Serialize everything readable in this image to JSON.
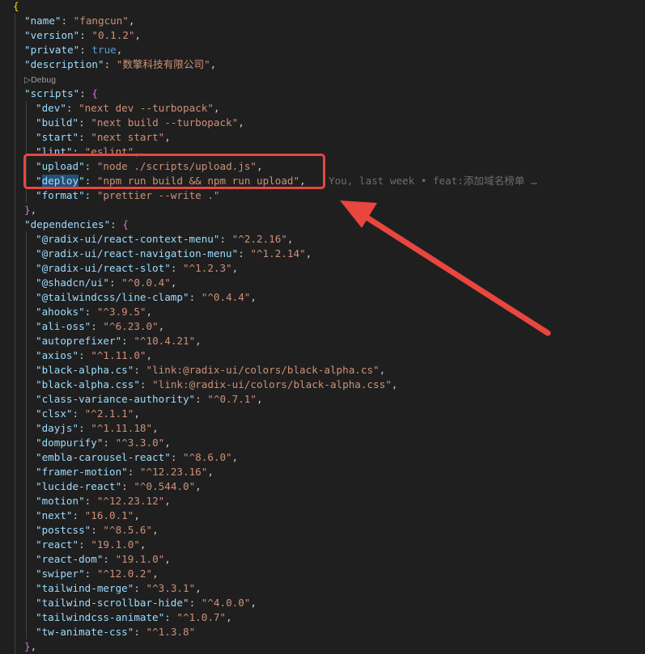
{
  "editor": {
    "lines": [
      {
        "segments": [
          {
            "t": "{",
            "c": "brace"
          }
        ]
      },
      {
        "indent": 1,
        "segments": [
          {
            "t": "\"name\"",
            "c": "key"
          },
          {
            "t": ": ",
            "c": "punct"
          },
          {
            "t": "\"fangcun\"",
            "c": "str"
          },
          {
            "t": ",",
            "c": "punct"
          }
        ]
      },
      {
        "indent": 1,
        "segments": [
          {
            "t": "\"version\"",
            "c": "key"
          },
          {
            "t": ": ",
            "c": "punct"
          },
          {
            "t": "\"0.1.2\"",
            "c": "str"
          },
          {
            "t": ",",
            "c": "punct"
          }
        ]
      },
      {
        "indent": 1,
        "segments": [
          {
            "t": "\"private\"",
            "c": "key"
          },
          {
            "t": ": ",
            "c": "punct"
          },
          {
            "t": "true",
            "c": "bool"
          },
          {
            "t": ",",
            "c": "punct"
          }
        ]
      },
      {
        "indent": 1,
        "segments": [
          {
            "t": "\"description\"",
            "c": "key"
          },
          {
            "t": ": ",
            "c": "punct"
          },
          {
            "t": "\"数擎科技有限公司\"",
            "c": "str"
          },
          {
            "t": ",",
            "c": "punct"
          }
        ]
      },
      {
        "indent": 1,
        "codelens": "▷Debug"
      },
      {
        "indent": 1,
        "segments": [
          {
            "t": "\"scripts\"",
            "c": "key"
          },
          {
            "t": ": ",
            "c": "punct"
          },
          {
            "t": "{",
            "c": "brace2"
          }
        ]
      },
      {
        "indent": 2,
        "segments": [
          {
            "t": "\"dev\"",
            "c": "key"
          },
          {
            "t": ": ",
            "c": "punct"
          },
          {
            "t": "\"next dev --turbopack\"",
            "c": "str"
          },
          {
            "t": ",",
            "c": "punct"
          }
        ]
      },
      {
        "indent": 2,
        "segments": [
          {
            "t": "\"build\"",
            "c": "key"
          },
          {
            "t": ": ",
            "c": "punct"
          },
          {
            "t": "\"next build --turbopack\"",
            "c": "str"
          },
          {
            "t": ",",
            "c": "punct"
          }
        ]
      },
      {
        "indent": 2,
        "segments": [
          {
            "t": "\"start\"",
            "c": "key"
          },
          {
            "t": ": ",
            "c": "punct"
          },
          {
            "t": "\"next start\"",
            "c": "str"
          },
          {
            "t": ",",
            "c": "punct"
          }
        ]
      },
      {
        "indent": 2,
        "segments": [
          {
            "t": "\"lint\"",
            "c": "key"
          },
          {
            "t": ": ",
            "c": "punct"
          },
          {
            "t": "\"eslint\"",
            "c": "str"
          },
          {
            "t": ",",
            "c": "punct"
          }
        ]
      },
      {
        "indent": 2,
        "segments": [
          {
            "t": "\"upload\"",
            "c": "key"
          },
          {
            "t": ": ",
            "c": "punct"
          },
          {
            "t": "\"node ./scripts/upload.js\"",
            "c": "str"
          },
          {
            "t": ",",
            "c": "punct"
          }
        ]
      },
      {
        "indent": 2,
        "segments": [
          {
            "t": "\"",
            "c": "key"
          },
          {
            "t": "deploy",
            "c": "key sel"
          },
          {
            "t": "\"",
            "c": "key"
          },
          {
            "t": ": ",
            "c": "punct"
          },
          {
            "t": "\"npm run build && npm run upload\"",
            "c": "str"
          },
          {
            "t": ",",
            "c": "punct"
          }
        ],
        "blame": "You, last week • feat:添加域名榜单 …"
      },
      {
        "indent": 2,
        "segments": [
          {
            "t": "\"format\"",
            "c": "key"
          },
          {
            "t": ": ",
            "c": "punct"
          },
          {
            "t": "\"prettier --write .\"",
            "c": "str"
          }
        ]
      },
      {
        "indent": 1,
        "segments": [
          {
            "t": "}",
            "c": "brace2"
          },
          {
            "t": ",",
            "c": "punct"
          }
        ]
      },
      {
        "indent": 1,
        "segments": [
          {
            "t": "\"dependencies\"",
            "c": "key"
          },
          {
            "t": ": ",
            "c": "punct"
          },
          {
            "t": "{",
            "c": "brace2"
          }
        ]
      },
      {
        "indent": 2,
        "segments": [
          {
            "t": "\"@radix-ui/react-context-menu\"",
            "c": "key"
          },
          {
            "t": ": ",
            "c": "punct"
          },
          {
            "t": "\"^2.2.16\"",
            "c": "str"
          },
          {
            "t": ",",
            "c": "punct"
          }
        ]
      },
      {
        "indent": 2,
        "segments": [
          {
            "t": "\"@radix-ui/react-navigation-menu\"",
            "c": "key"
          },
          {
            "t": ": ",
            "c": "punct"
          },
          {
            "t": "\"^1.2.14\"",
            "c": "str"
          },
          {
            "t": ",",
            "c": "punct"
          }
        ]
      },
      {
        "indent": 2,
        "segments": [
          {
            "t": "\"@radix-ui/react-slot\"",
            "c": "key"
          },
          {
            "t": ": ",
            "c": "punct"
          },
          {
            "t": "\"^1.2.3\"",
            "c": "str"
          },
          {
            "t": ",",
            "c": "punct"
          }
        ]
      },
      {
        "indent": 2,
        "segments": [
          {
            "t": "\"@shadcn/ui\"",
            "c": "key"
          },
          {
            "t": ": ",
            "c": "punct"
          },
          {
            "t": "\"^0.0.4\"",
            "c": "str"
          },
          {
            "t": ",",
            "c": "punct"
          }
        ]
      },
      {
        "indent": 2,
        "segments": [
          {
            "t": "\"@tailwindcss/line-clamp\"",
            "c": "key"
          },
          {
            "t": ": ",
            "c": "punct"
          },
          {
            "t": "\"^0.4.4\"",
            "c": "str"
          },
          {
            "t": ",",
            "c": "punct"
          }
        ]
      },
      {
        "indent": 2,
        "segments": [
          {
            "t": "\"ahooks\"",
            "c": "key"
          },
          {
            "t": ": ",
            "c": "punct"
          },
          {
            "t": "\"^3.9.5\"",
            "c": "str"
          },
          {
            "t": ",",
            "c": "punct"
          }
        ]
      },
      {
        "indent": 2,
        "segments": [
          {
            "t": "\"ali-oss\"",
            "c": "key"
          },
          {
            "t": ": ",
            "c": "punct"
          },
          {
            "t": "\"^6.23.0\"",
            "c": "str"
          },
          {
            "t": ",",
            "c": "punct"
          }
        ]
      },
      {
        "indent": 2,
        "segments": [
          {
            "t": "\"autoprefixer\"",
            "c": "key"
          },
          {
            "t": ": ",
            "c": "punct"
          },
          {
            "t": "\"^10.4.21\"",
            "c": "str"
          },
          {
            "t": ",",
            "c": "punct"
          }
        ]
      },
      {
        "indent": 2,
        "segments": [
          {
            "t": "\"axios\"",
            "c": "key"
          },
          {
            "t": ": ",
            "c": "punct"
          },
          {
            "t": "\"^1.11.0\"",
            "c": "str"
          },
          {
            "t": ",",
            "c": "punct"
          }
        ]
      },
      {
        "indent": 2,
        "segments": [
          {
            "t": "\"black-alpha.cs\"",
            "c": "key"
          },
          {
            "t": ": ",
            "c": "punct"
          },
          {
            "t": "\"link:@radix-ui/colors/black-alpha.cs\"",
            "c": "str"
          },
          {
            "t": ",",
            "c": "punct"
          }
        ]
      },
      {
        "indent": 2,
        "segments": [
          {
            "t": "\"black-alpha.css\"",
            "c": "key"
          },
          {
            "t": ": ",
            "c": "punct"
          },
          {
            "t": "\"link:@radix-ui/colors/black-alpha.css\"",
            "c": "str"
          },
          {
            "t": ",",
            "c": "punct"
          }
        ]
      },
      {
        "indent": 2,
        "segments": [
          {
            "t": "\"class-variance-authority\"",
            "c": "key"
          },
          {
            "t": ": ",
            "c": "punct"
          },
          {
            "t": "\"^0.7.1\"",
            "c": "str"
          },
          {
            "t": ",",
            "c": "punct"
          }
        ]
      },
      {
        "indent": 2,
        "segments": [
          {
            "t": "\"clsx\"",
            "c": "key"
          },
          {
            "t": ": ",
            "c": "punct"
          },
          {
            "t": "\"^2.1.1\"",
            "c": "str"
          },
          {
            "t": ",",
            "c": "punct"
          }
        ]
      },
      {
        "indent": 2,
        "segments": [
          {
            "t": "\"dayjs\"",
            "c": "key"
          },
          {
            "t": ": ",
            "c": "punct"
          },
          {
            "t": "\"^1.11.18\"",
            "c": "str"
          },
          {
            "t": ",",
            "c": "punct"
          }
        ]
      },
      {
        "indent": 2,
        "segments": [
          {
            "t": "\"dompurify\"",
            "c": "key"
          },
          {
            "t": ": ",
            "c": "punct"
          },
          {
            "t": "\"^3.3.0\"",
            "c": "str"
          },
          {
            "t": ",",
            "c": "punct"
          }
        ]
      },
      {
        "indent": 2,
        "segments": [
          {
            "t": "\"embla-carousel-react\"",
            "c": "key"
          },
          {
            "t": ": ",
            "c": "punct"
          },
          {
            "t": "\"^8.6.0\"",
            "c": "str"
          },
          {
            "t": ",",
            "c": "punct"
          }
        ]
      },
      {
        "indent": 2,
        "segments": [
          {
            "t": "\"framer-motion\"",
            "c": "key"
          },
          {
            "t": ": ",
            "c": "punct"
          },
          {
            "t": "\"^12.23.16\"",
            "c": "str"
          },
          {
            "t": ",",
            "c": "punct"
          }
        ]
      },
      {
        "indent": 2,
        "segments": [
          {
            "t": "\"lucide-react\"",
            "c": "key"
          },
          {
            "t": ": ",
            "c": "punct"
          },
          {
            "t": "\"^0.544.0\"",
            "c": "str"
          },
          {
            "t": ",",
            "c": "punct"
          }
        ]
      },
      {
        "indent": 2,
        "segments": [
          {
            "t": "\"motion\"",
            "c": "key"
          },
          {
            "t": ": ",
            "c": "punct"
          },
          {
            "t": "\"^12.23.12\"",
            "c": "str"
          },
          {
            "t": ",",
            "c": "punct"
          }
        ]
      },
      {
        "indent": 2,
        "segments": [
          {
            "t": "\"next\"",
            "c": "key"
          },
          {
            "t": ": ",
            "c": "punct"
          },
          {
            "t": "\"16.0.1\"",
            "c": "str"
          },
          {
            "t": ",",
            "c": "punct"
          }
        ]
      },
      {
        "indent": 2,
        "segments": [
          {
            "t": "\"postcss\"",
            "c": "key"
          },
          {
            "t": ": ",
            "c": "punct"
          },
          {
            "t": "\"^8.5.6\"",
            "c": "str"
          },
          {
            "t": ",",
            "c": "punct"
          }
        ]
      },
      {
        "indent": 2,
        "segments": [
          {
            "t": "\"react\"",
            "c": "key"
          },
          {
            "t": ": ",
            "c": "punct"
          },
          {
            "t": "\"19.1.0\"",
            "c": "str"
          },
          {
            "t": ",",
            "c": "punct"
          }
        ]
      },
      {
        "indent": 2,
        "segments": [
          {
            "t": "\"react-dom\"",
            "c": "key"
          },
          {
            "t": ": ",
            "c": "punct"
          },
          {
            "t": "\"19.1.0\"",
            "c": "str"
          },
          {
            "t": ",",
            "c": "punct"
          }
        ]
      },
      {
        "indent": 2,
        "segments": [
          {
            "t": "\"swiper\"",
            "c": "key"
          },
          {
            "t": ": ",
            "c": "punct"
          },
          {
            "t": "\"^12.0.2\"",
            "c": "str"
          },
          {
            "t": ",",
            "c": "punct"
          }
        ]
      },
      {
        "indent": 2,
        "segments": [
          {
            "t": "\"tailwind-merge\"",
            "c": "key"
          },
          {
            "t": ": ",
            "c": "punct"
          },
          {
            "t": "\"^3.3.1\"",
            "c": "str"
          },
          {
            "t": ",",
            "c": "punct"
          }
        ]
      },
      {
        "indent": 2,
        "segments": [
          {
            "t": "\"tailwind-scrollbar-hide\"",
            "c": "key"
          },
          {
            "t": ": ",
            "c": "punct"
          },
          {
            "t": "\"^4.0.0\"",
            "c": "str"
          },
          {
            "t": ",",
            "c": "punct"
          }
        ]
      },
      {
        "indent": 2,
        "segments": [
          {
            "t": "\"tailwindcss-animate\"",
            "c": "key"
          },
          {
            "t": ": ",
            "c": "punct"
          },
          {
            "t": "\"^1.0.7\"",
            "c": "str"
          },
          {
            "t": ",",
            "c": "punct"
          }
        ]
      },
      {
        "indent": 2,
        "segments": [
          {
            "t": "\"tw-animate-css\"",
            "c": "key"
          },
          {
            "t": ": ",
            "c": "punct"
          },
          {
            "t": "\"^1.3.8\"",
            "c": "str"
          }
        ]
      },
      {
        "indent": 1,
        "segments": [
          {
            "t": "}",
            "c": "brace2"
          },
          {
            "t": ",",
            "c": "punct"
          }
        ]
      }
    ]
  },
  "colors": {
    "background": "#1f1f1f",
    "key": "#9cdcfe",
    "string": "#ce9178",
    "boolean": "#569cd6",
    "annotation": "#e8463f"
  },
  "annotation": {
    "box_icon": "highlight-box",
    "arrow_icon": "pointer-arrow"
  }
}
